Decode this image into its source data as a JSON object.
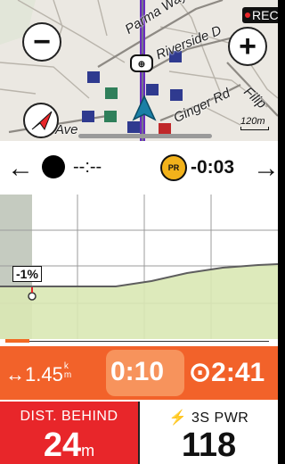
{
  "map": {
    "streets": [
      "Parma Way",
      "Riverside D",
      "a Ave",
      "Ginger Rd",
      "Filip"
    ],
    "scale_label": "120m",
    "rec_label": "REC",
    "zoom_out_label": "−",
    "zoom_in_label": "+",
    "icons": [
      "zoom-out-icon",
      "zoom-in-icon",
      "compass-arrow-icon",
      "position-arrow-icon",
      "poi-school-icon",
      "poi-bank-icon",
      "poi-restaurant-icon",
      "poi-house-icon"
    ]
  },
  "course_nav": {
    "rider_time": "--:--",
    "pr_badge_label": "PR",
    "pr_time": "-0:03",
    "icons": [
      "arrow-left-icon",
      "arrow-right-icon"
    ]
  },
  "elevation": {
    "grade_label": "-1%"
  },
  "progress": {
    "fraction": 0.09
  },
  "data_fields": {
    "distance_ahead": {
      "arrow": "↔",
      "value": "1.45",
      "unit_top": "k",
      "unit_bottom": "m"
    },
    "timer": "0:10",
    "eta": {
      "icon": "⊙",
      "value": "2:41"
    },
    "dist_behind": {
      "title": "DIST. BEHIND",
      "value": "24",
      "unit": "m"
    },
    "power": {
      "icon": "⚡",
      "title": "3S PWR",
      "value": "118"
    }
  },
  "colors": {
    "orange": "#f2622a",
    "red": "#e8262a",
    "elevation_fill": "#d9e8b4",
    "route": "#6a2bbf",
    "gold": "#f2b21b"
  }
}
